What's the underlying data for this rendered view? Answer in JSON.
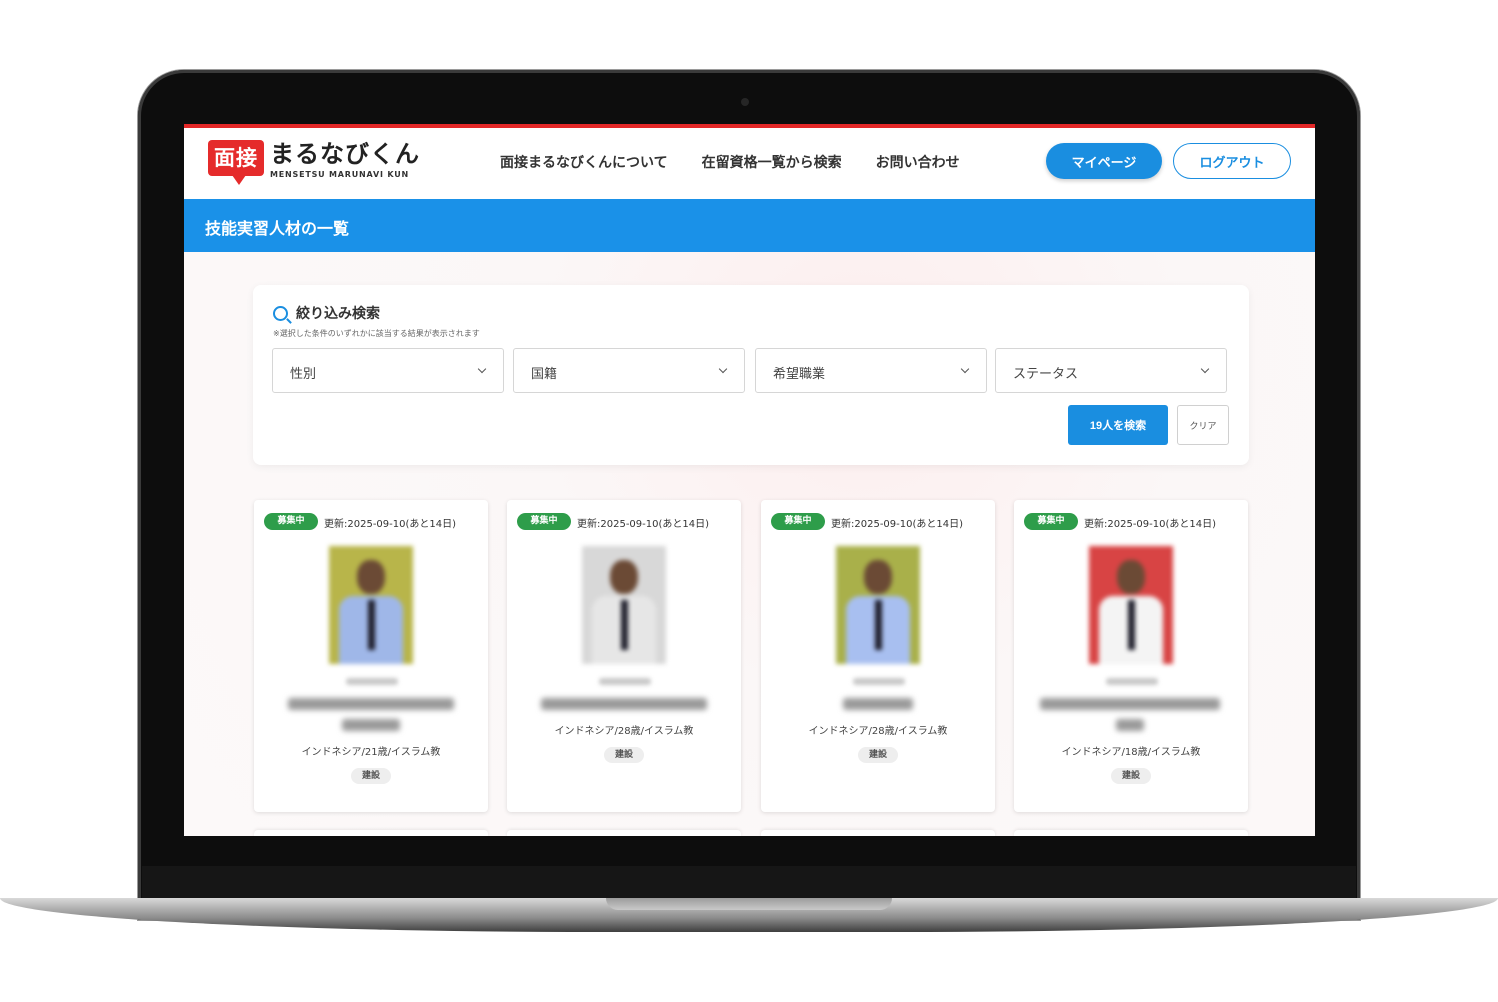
{
  "header": {
    "logo_badge": "面接",
    "logo_main": "まるなびくん",
    "logo_sub": "MENSETSU MARUNAVI KUN",
    "nav": [
      "面接まるなびくんについて",
      "在留資格一覧から検索",
      "お問い合わせ"
    ],
    "mypage_label": "マイページ",
    "logout_label": "ログアウト"
  },
  "page_title": "技能実習人材の一覧",
  "filter": {
    "title": "絞り込み検索",
    "note": "※選択した条件のいずれかに該当する結果が表示されます",
    "selects": [
      "性別",
      "国籍",
      "希望職業",
      "ステータス"
    ],
    "search_label": "19人を検索",
    "clear_label": "クリア"
  },
  "cards": [
    {
      "status": "募集中",
      "updated": "更新:2025-09-10(あと14日)",
      "info": "インドネシア/21歳/イスラム教",
      "tag": "建設",
      "bg": "#b8b54a",
      "shirt": "#9fb7e8"
    },
    {
      "status": "募集中",
      "updated": "更新:2025-09-10(あと14日)",
      "info": "インドネシア/28歳/イスラム教",
      "tag": "建設",
      "bg": "#d8d8d8",
      "shirt": "#e6e6e6"
    },
    {
      "status": "募集中",
      "updated": "更新:2025-09-10(あと14日)",
      "info": "インドネシア/28歳/イスラム教",
      "tag": "建設",
      "bg": "#a9b04a",
      "shirt": "#a8bff0"
    },
    {
      "status": "募集中",
      "updated": "更新:2025-09-10(あと14日)",
      "info": "インドネシア/18歳/イスラム教",
      "tag": "建設",
      "bg": "#d84444",
      "shirt": "#f4f4f4"
    }
  ]
}
